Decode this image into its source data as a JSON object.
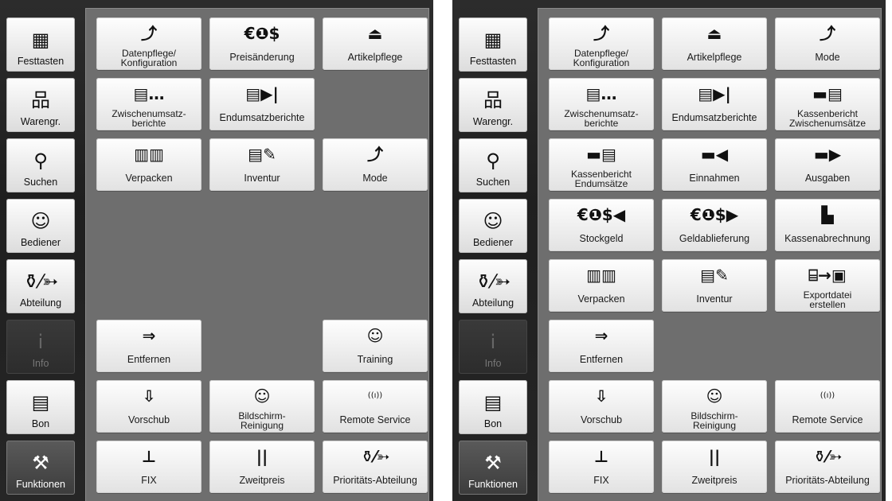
{
  "sidebar": [
    {
      "label": "Festtasten",
      "icon": "grid-icon",
      "glyph": "▦",
      "state": "normal"
    },
    {
      "label": "Warengr.",
      "icon": "hierarchy-icon",
      "glyph": "品",
      "state": "normal"
    },
    {
      "label": "Suchen",
      "icon": "magnifier-icon",
      "glyph": "⚲",
      "state": "normal"
    },
    {
      "label": "Bediener",
      "icon": "person-icon",
      "glyph": "☺",
      "state": "normal"
    },
    {
      "label": "Abteilung",
      "icon": "department-icon",
      "glyph": "⚱⁄➳",
      "state": "normal"
    },
    {
      "label": "Info",
      "icon": "info-icon",
      "glyph": "i",
      "state": "disabled"
    },
    {
      "label": "Bon",
      "icon": "receipt-icon",
      "glyph": "▤",
      "state": "normal"
    },
    {
      "label": "Funktionen",
      "icon": "wrench-icon",
      "glyph": "⚒",
      "state": "active"
    }
  ],
  "left_tiles": [
    {
      "label": "Datenpflege/\nKonfiguration",
      "icon": "config-icon",
      "glyph": "⤴",
      "col": 0,
      "row": 0
    },
    {
      "label": "Preisänderung",
      "icon": "coins-icon",
      "glyph": "€❶$",
      "col": 1,
      "row": 0
    },
    {
      "label": "Artikelpflege",
      "icon": "scale-icon",
      "glyph": "⏏",
      "col": 2,
      "row": 0
    },
    {
      "label": "Zwischenumsatz-\nberichte",
      "icon": "report-interim-icon",
      "glyph": "▤…",
      "col": 0,
      "row": 1
    },
    {
      "label": "Endumsatzberichte",
      "icon": "report-final-icon",
      "glyph": "▤▶|",
      "col": 1,
      "row": 1
    },
    {
      "label": "Verpacken",
      "icon": "packaging-icon",
      "glyph": "▥▥",
      "col": 0,
      "row": 2
    },
    {
      "label": "Inventur",
      "icon": "inventory-icon",
      "glyph": "▤✎",
      "col": 1,
      "row": 2
    },
    {
      "label": "Mode",
      "icon": "mode-icon",
      "glyph": "⤴",
      "col": 2,
      "row": 2
    },
    {
      "label": "Entfernen",
      "icon": "remove-icon",
      "glyph": "⇒",
      "col": 0,
      "row": 5
    },
    {
      "label": "Training",
      "icon": "training-icon",
      "glyph": "☺",
      "col": 2,
      "row": 5
    },
    {
      "label": "Vorschub",
      "icon": "feed-icon",
      "glyph": "⇩",
      "col": 0,
      "row": 6
    },
    {
      "label": "Bildschirm-\nReinigung",
      "icon": "screen-clean-icon",
      "glyph": "☺",
      "col": 1,
      "row": 6
    },
    {
      "label": "Remote Service",
      "icon": "remote-icon",
      "glyph": "((ı))",
      "col": 2,
      "row": 6
    },
    {
      "label": "FIX",
      "icon": "pin-icon",
      "glyph": "⊥",
      "col": 0,
      "row": 7
    },
    {
      "label": "Zweitpreis",
      "icon": "pause-icon",
      "glyph": "||",
      "col": 1,
      "row": 7
    },
    {
      "label": "Prioritäts-Abteilung",
      "icon": "priority-dept-icon",
      "glyph": "⚱⁄➳",
      "col": 2,
      "row": 7
    }
  ],
  "right_tiles": [
    {
      "label": "Datenpflege/\nKonfiguration",
      "icon": "config-icon",
      "glyph": "⤴",
      "col": 0,
      "row": 0
    },
    {
      "label": "Artikelpflege",
      "icon": "scale-icon",
      "glyph": "⏏",
      "col": 1,
      "row": 0
    },
    {
      "label": "Mode",
      "icon": "mode-icon",
      "glyph": "⤴",
      "col": 2,
      "row": 0
    },
    {
      "label": "Zwischenumsatz-\nberichte",
      "icon": "report-interim-icon",
      "glyph": "▤…",
      "col": 0,
      "row": 1
    },
    {
      "label": "Endumsatzberichte",
      "icon": "report-final-icon",
      "glyph": "▤▶|",
      "col": 1,
      "row": 1
    },
    {
      "label": "Kassenbericht\nZwischenumsätze",
      "icon": "cash-report-interim-icon",
      "glyph": "▬▤",
      "col": 2,
      "row": 1
    },
    {
      "label": "Kassenbericht\nEndumsätze",
      "icon": "cash-report-final-icon",
      "glyph": "▬▤",
      "col": 0,
      "row": 2
    },
    {
      "label": "Einnahmen",
      "icon": "income-icon",
      "glyph": "▬◀",
      "col": 1,
      "row": 2
    },
    {
      "label": "Ausgaben",
      "icon": "expense-icon",
      "glyph": "▬▶",
      "col": 2,
      "row": 2
    },
    {
      "label": "Stockgeld",
      "icon": "float-icon",
      "glyph": "€❶$◀",
      "col": 0,
      "row": 3
    },
    {
      "label": "Geldablieferung",
      "icon": "cash-delivery-icon",
      "glyph": "€❶$▶",
      "col": 1,
      "row": 3
    },
    {
      "label": "Kassenabrechnung",
      "icon": "settlement-icon",
      "glyph": "▙",
      "col": 2,
      "row": 3
    },
    {
      "label": "Verpacken",
      "icon": "packaging-icon",
      "glyph": "▥▥",
      "col": 0,
      "row": 4
    },
    {
      "label": "Inventur",
      "icon": "inventory-icon",
      "glyph": "▤✎",
      "col": 1,
      "row": 4
    },
    {
      "label": "Exportdatei\nerstellen",
      "icon": "export-icon",
      "glyph": "⌸→▣",
      "col": 2,
      "row": 4
    },
    {
      "label": "Entfernen",
      "icon": "remove-icon",
      "glyph": "⇒",
      "col": 0,
      "row": 5
    },
    {
      "label": "Vorschub",
      "icon": "feed-icon",
      "glyph": "⇩",
      "col": 0,
      "row": 6
    },
    {
      "label": "Bildschirm-\nReinigung",
      "icon": "screen-clean-icon",
      "glyph": "☺",
      "col": 1,
      "row": 6
    },
    {
      "label": "Remote Service",
      "icon": "remote-icon",
      "glyph": "((ı))",
      "col": 2,
      "row": 6
    },
    {
      "label": "FIX",
      "icon": "pin-icon",
      "glyph": "⊥",
      "col": 0,
      "row": 7
    },
    {
      "label": "Zweitpreis",
      "icon": "pause-icon",
      "glyph": "||",
      "col": 1,
      "row": 7
    },
    {
      "label": "Prioritäts-Abteilung",
      "icon": "priority-dept-icon",
      "glyph": "⚱⁄➳",
      "col": 2,
      "row": 7
    }
  ]
}
